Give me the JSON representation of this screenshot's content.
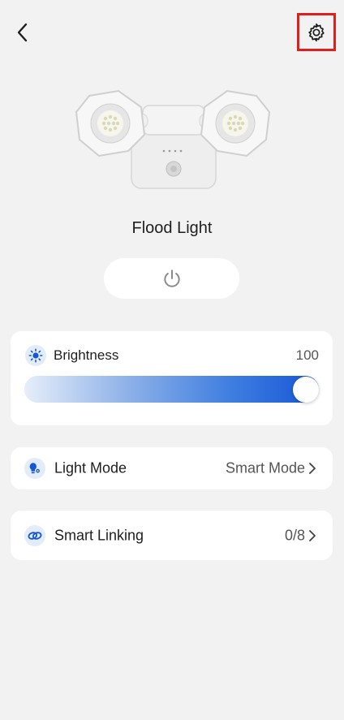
{
  "header": {
    "back_icon": "chevron-left-icon",
    "settings_icon": "gear-icon"
  },
  "device": {
    "name": "Flood Light",
    "image": "flood-light-device-image",
    "power_icon": "power-icon"
  },
  "brightness": {
    "label": "Brightness",
    "value": "100",
    "level_percent": 100,
    "icon": "sun-icon"
  },
  "light_mode": {
    "label": "Light Mode",
    "value": "Smart Mode",
    "icon": "bulb-settings-icon"
  },
  "smart_linking": {
    "label": "Smart Linking",
    "value": "0/8",
    "icon": "link-icon"
  },
  "colors": {
    "accent": "#1556d6",
    "highlight_box": "#e01e1e",
    "background": "#f2f2f2",
    "card": "#ffffff"
  }
}
